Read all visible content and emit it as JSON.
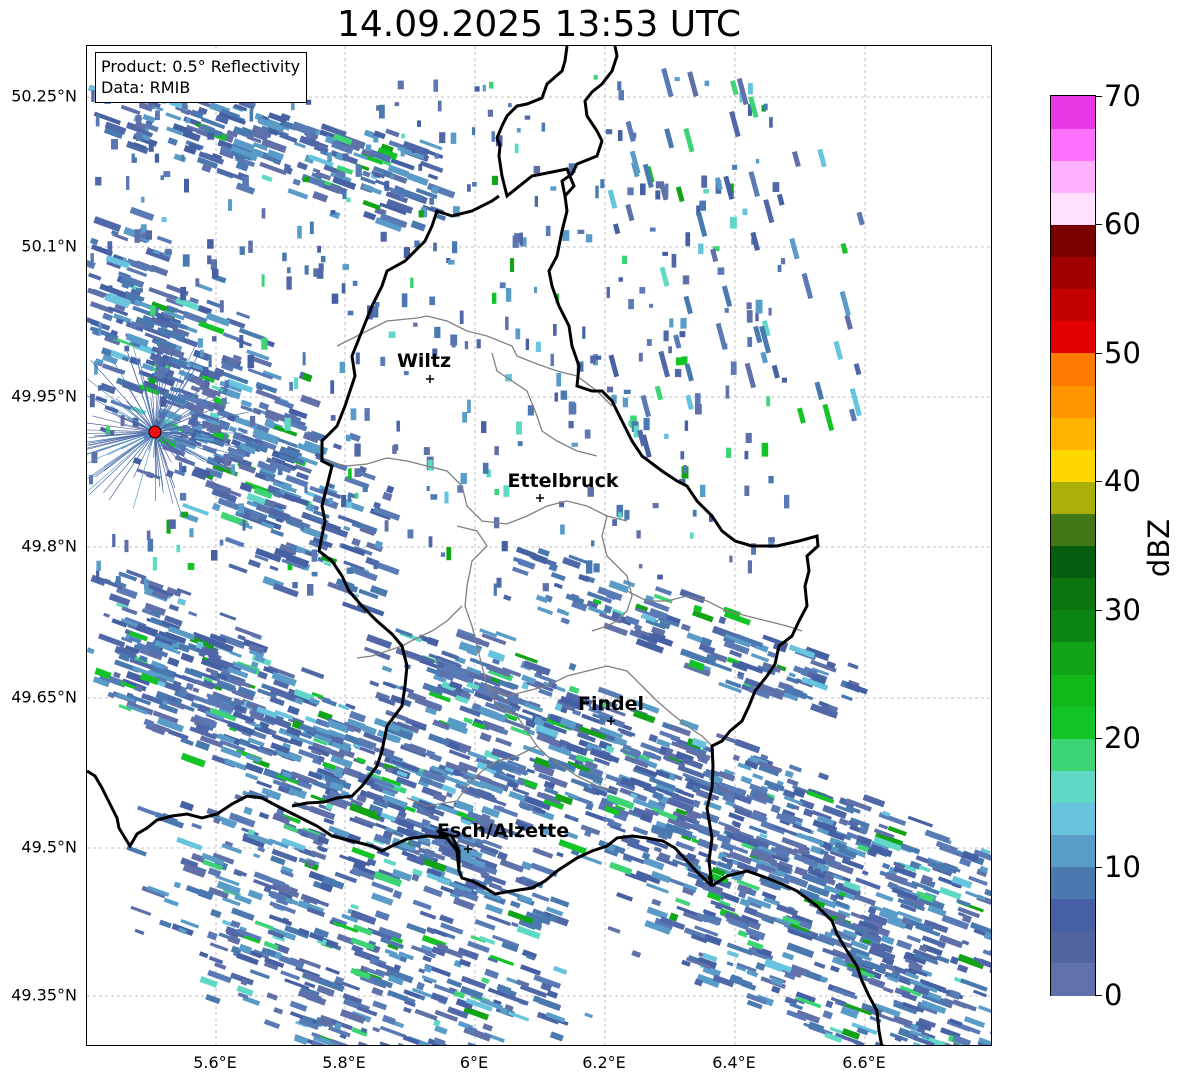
{
  "title": "14.09.2025 13:53 UTC",
  "info": {
    "product": "Product: 0.5° Reflectivity",
    "data_source": "Data: RMIB"
  },
  "latitude_labels": [
    "50.25°N",
    "50.1°N",
    "49.95°N",
    "49.8°N",
    "49.65°N",
    "49.5°N",
    "49.35°N"
  ],
  "longitude_labels": [
    "5.6°E",
    "5.8°E",
    "6°E",
    "6.2°E",
    "6.4°E",
    "6.6°E"
  ],
  "cities": [
    {
      "name": "Wiltz"
    },
    {
      "name": "Ettelbruck"
    },
    {
      "name": "Findel"
    },
    {
      "name": "Esch/Alzette"
    }
  ],
  "radar_site": "radar-station-marker",
  "colorbar": {
    "label": "dBZ",
    "min": 0,
    "max": 70,
    "step": 2.5,
    "ticks": [
      "0",
      "10",
      "20",
      "30",
      "40",
      "50",
      "60",
      "70"
    ],
    "colors": [
      "#6070a8",
      "#50649f",
      "#4560a3",
      "#4a79b0",
      "#5a9cc8",
      "#68c3de",
      "#60d8c6",
      "#3dd475",
      "#13c426",
      "#12b719",
      "#11a416",
      "#0d8514",
      "#0c7510",
      "#065d10",
      "#437817",
      "#aab008",
      "#ffd700",
      "#ffb300",
      "#ff9500",
      "#ff7a00",
      "#e20000",
      "#c40000",
      "#a20000",
      "#7a0000",
      "#ffe0ff",
      "#ffb0ff",
      "#ff70ff",
      "#e838e8"
    ]
  },
  "grid_lines": true
}
